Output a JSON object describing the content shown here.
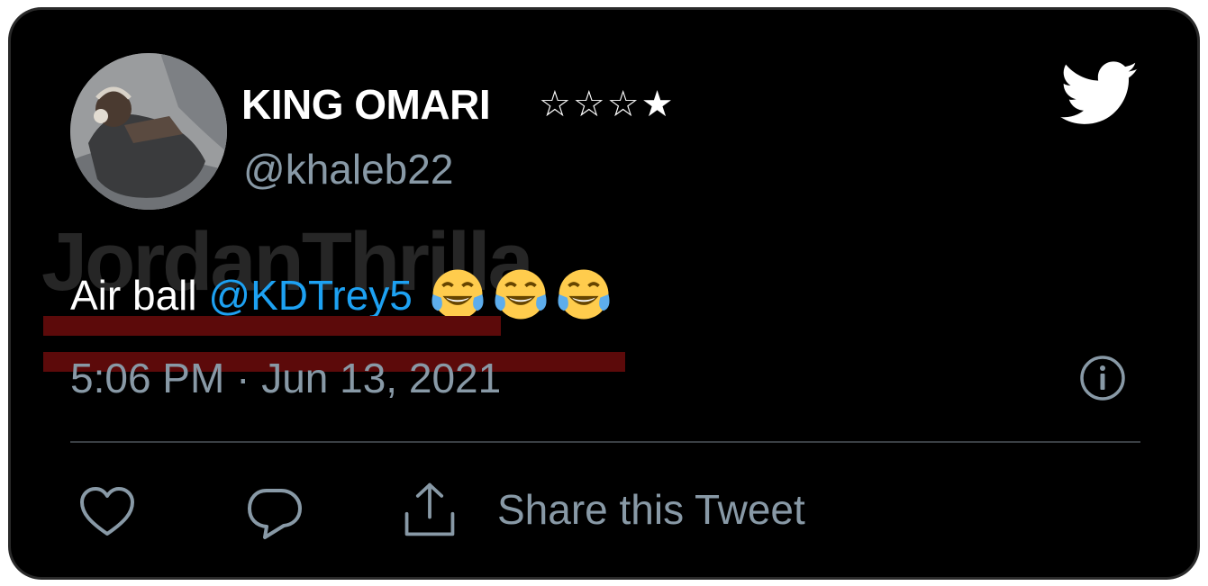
{
  "tweet": {
    "display_name": "KING OMARI",
    "name_stars": "☆☆☆★",
    "handle": "@khaleb22",
    "text": "Air ball",
    "mention": "@KDTrey5",
    "emojis": [
      "face-with-tears-of-joy",
      "face-with-tears-of-joy",
      "face-with-tears-of-joy"
    ],
    "timestamp": "5:06 PM · Jun 13, 2021"
  },
  "watermark": "JordanThrilla",
  "actions": {
    "share_label": "Share this Tweet",
    "icons": [
      "heart-icon",
      "reply-icon",
      "share-icon"
    ]
  },
  "colors": {
    "background": "#000000",
    "text": "#ffffff",
    "secondary": "#8899a6",
    "mention": "#1da1f2",
    "twitter_bird": "#ffffff"
  }
}
